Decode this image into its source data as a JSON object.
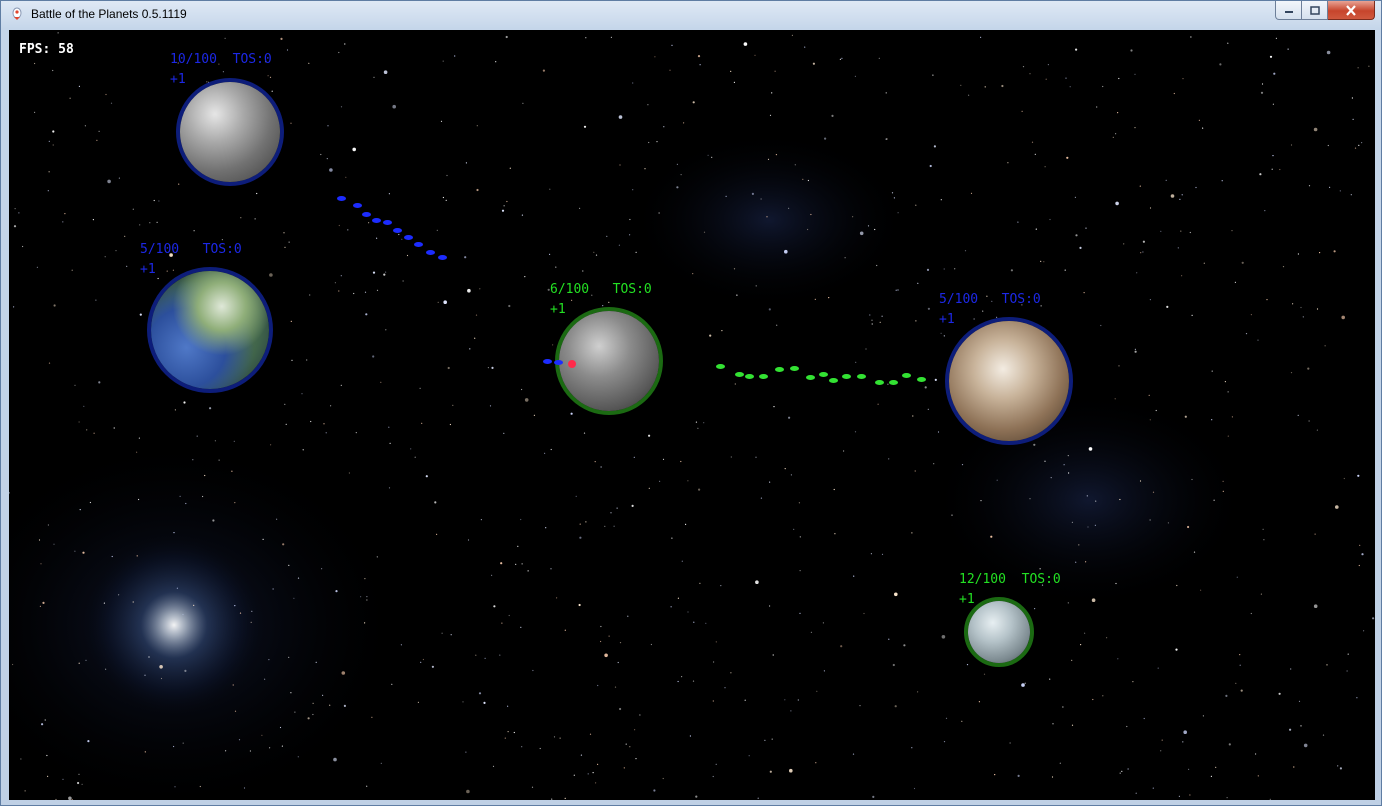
{
  "window": {
    "title": "Battle of the Planets 0.5.1119"
  },
  "hud": {
    "fps": "FPS: 58"
  },
  "colors": {
    "blue_team": "#1c28e6",
    "green_team": "#23e023",
    "space": "#000000"
  },
  "planets": [
    {
      "id": "p1",
      "team": "blue",
      "count": "10/100",
      "tos": "TOS:0",
      "rate": "+1",
      "texture": "grey-moon"
    },
    {
      "id": "p2",
      "team": "blue",
      "count": "5/100",
      "tos": "TOS:0",
      "rate": "+1",
      "texture": "earth-like"
    },
    {
      "id": "p3",
      "team": "green",
      "count": "6/100",
      "tos": "TOS:0",
      "rate": "+1",
      "texture": "grey-rocky"
    },
    {
      "id": "p4",
      "team": "blue",
      "count": "5/100",
      "tos": "TOS:0",
      "rate": "+1",
      "texture": "brown-desert"
    },
    {
      "id": "p5",
      "team": "green",
      "count": "12/100",
      "tos": "TOS:0",
      "rate": "+1",
      "texture": "icy"
    }
  ]
}
